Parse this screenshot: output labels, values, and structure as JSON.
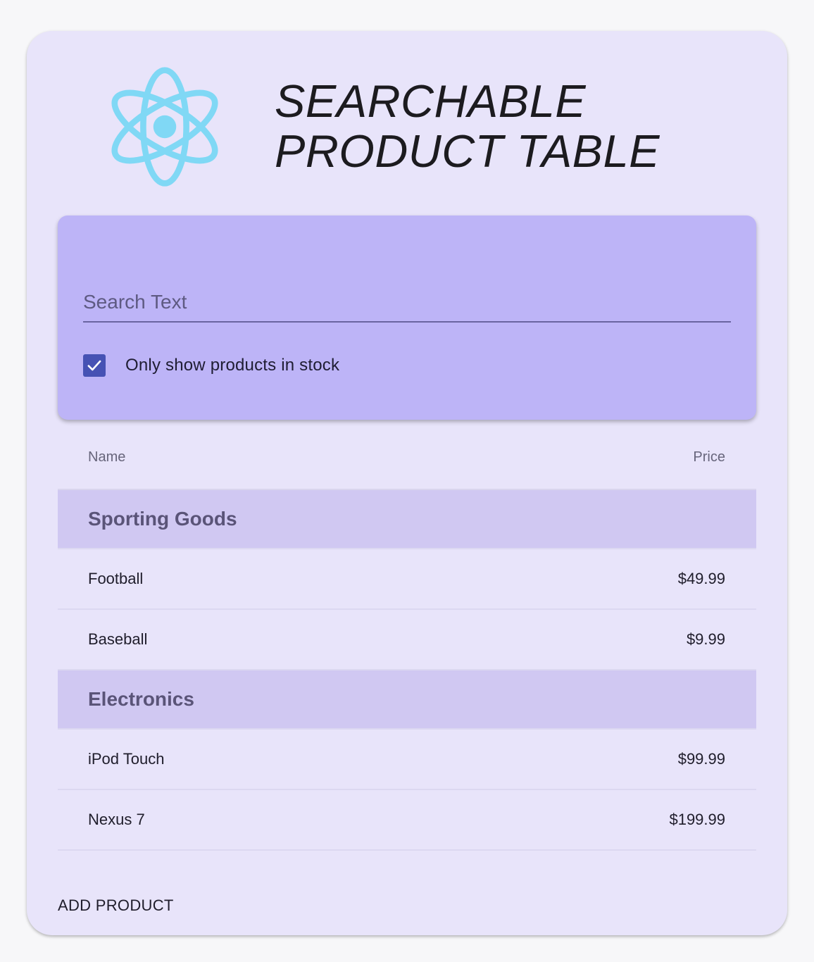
{
  "app": {
    "title_line1": "SEARCHABLE",
    "title_line2": "PRODUCT TABLE"
  },
  "colors": {
    "card_background": "#e8e4fa",
    "filter_panel": "#bdb4f7",
    "category_row": "#d0c8f2",
    "checkbox": "#4652b4",
    "logo": "#80d8f5"
  },
  "filter": {
    "search_placeholder": "Search Text",
    "search_value": "",
    "stock_checked": true,
    "stock_label": "Only show products in stock"
  },
  "table": {
    "headers": {
      "name": "Name",
      "price": "Price"
    },
    "categories": [
      {
        "name": "Sporting Goods",
        "products": [
          {
            "name": "Football",
            "price": "$49.99"
          },
          {
            "name": "Baseball",
            "price": "$9.99"
          }
        ]
      },
      {
        "name": "Electronics",
        "products": [
          {
            "name": "iPod Touch",
            "price": "$99.99"
          },
          {
            "name": "Nexus 7",
            "price": "$199.99"
          }
        ]
      }
    ]
  },
  "actions": {
    "add_product_label": "ADD PRODUCT"
  }
}
